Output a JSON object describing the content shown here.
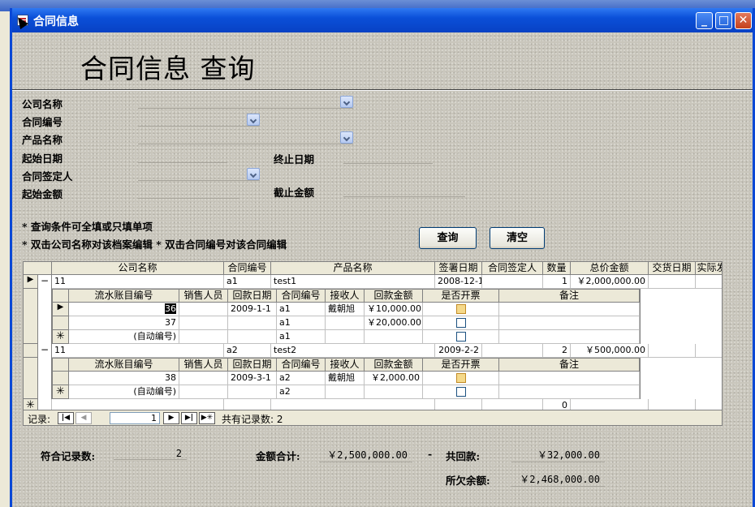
{
  "window": {
    "title": "合同信息"
  },
  "form": {
    "heading": "合同信息  查询",
    "labels": {
      "company": "公司名称",
      "contract_no": "合同编号",
      "product": "产品名称",
      "start_date": "起始日期",
      "end_date": "终止日期",
      "signer": "合同签定人",
      "start_amount": "起始金额",
      "end_amount": "截止金额"
    },
    "notes": [
      "* 查询条件可全填或只填单项",
      "* 双击公司名称对该档案编辑  * 双击合同编号对该合同编辑"
    ],
    "buttons": {
      "query": "查询",
      "clear": "清空"
    }
  },
  "grid": {
    "columns": [
      "公司名称",
      "合同编号",
      "产品名称",
      "签署日期",
      "合同签定人",
      "数量",
      "总价金额",
      "交货日期",
      "实际发"
    ],
    "sub_columns": [
      "流水账目编号",
      "销售人员",
      "回款日期",
      "合同编号",
      "接收人",
      "回款金额",
      "是否开票",
      "备注"
    ],
    "rows": [
      {
        "company": "11",
        "contract_no": "a1",
        "product": "test1",
        "sign_date": "2008-12-1",
        "signer": "",
        "qty": "1",
        "total": "￥2,000,000.00",
        "delivery": "",
        "actual": "",
        "subrows": [
          {
            "id": "36",
            "sales": "",
            "date": "2009-1-1",
            "contract_no": "a1",
            "receiver": "戴朝旭",
            "amount": "￥10,000.00",
            "invoiced": true,
            "remark": ""
          },
          {
            "id": "37",
            "sales": "",
            "date": "",
            "contract_no": "a1",
            "receiver": "",
            "amount": "￥20,000.00",
            "invoiced": false,
            "remark": ""
          },
          {
            "id": "(自动编号)",
            "sales": "",
            "date": "",
            "contract_no": "a1",
            "receiver": "",
            "amount": "",
            "invoiced": false,
            "remark": ""
          }
        ]
      },
      {
        "company": "11",
        "contract_no": "a2",
        "product": "test2",
        "sign_date": "2009-2-2",
        "signer": "",
        "qty": "2",
        "total": "￥500,000.00",
        "delivery": "",
        "actual": "",
        "subrows": [
          {
            "id": "38",
            "sales": "",
            "date": "2009-3-1",
            "contract_no": "a2",
            "receiver": "戴朝旭",
            "amount": "￥2,000.00",
            "invoiced": true,
            "remark": ""
          },
          {
            "id": "(自动编号)",
            "sales": "",
            "date": "",
            "contract_no": "a2",
            "receiver": "",
            "amount": "",
            "invoiced": false,
            "remark": ""
          }
        ]
      }
    ],
    "new_row_qty": "0"
  },
  "navigator": {
    "label": "记录:",
    "current": "1",
    "total_text": "共有记录数: 2"
  },
  "summary": {
    "count_label": "符合记录数:",
    "count_value": "2",
    "amount_label": "金额合计:",
    "amount_value": "￥2,500,000.00",
    "dash": "-",
    "received_label": "共回款:",
    "received_value": "￥32,000.00",
    "balance_label": "所欠余额:",
    "balance_value": "￥2,468,000.00"
  }
}
